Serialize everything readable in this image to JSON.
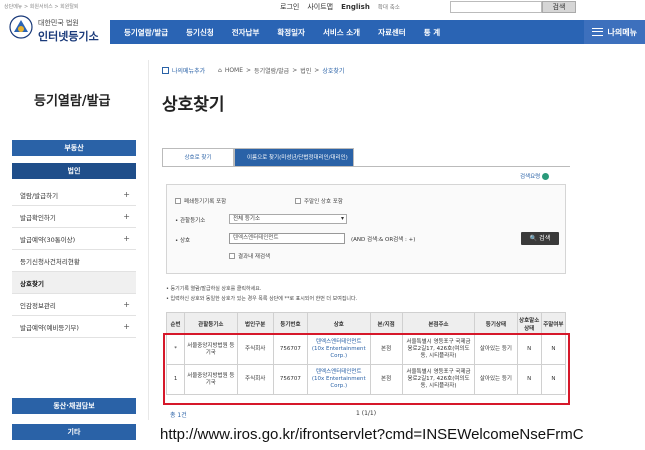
{
  "top_breadcrumb": "상단메뉴 > 회원서비스 > 회원탈퇴",
  "logo": {
    "sub": "대한민국 법원",
    "main": "인터넷등기소"
  },
  "util": {
    "login": "로그인",
    "sitemap": "사이트맵",
    "english": "English",
    "font_size": "확대 축소",
    "search_btn": "검색"
  },
  "nav": {
    "items": [
      "등기열람/발급",
      "등기신청",
      "전자납부",
      "확정일자",
      "서비스 소개",
      "자료센터",
      "통 계"
    ],
    "my_menu": "나의메뉴"
  },
  "sidebar": {
    "title": "등기열람/발급",
    "btn_realestate": "부동산",
    "btn_corp": "법인",
    "items": [
      {
        "label": "열람/발급하기",
        "plus": "+"
      },
      {
        "label": "발급확인하기",
        "plus": "+"
      },
      {
        "label": "발급예약(30통이상)",
        "plus": "+"
      },
      {
        "label": "등기신청사건처리현황",
        "plus": ""
      },
      {
        "label": "상호찾기",
        "plus": ""
      },
      {
        "label": "인감정보관리",
        "plus": "+"
      },
      {
        "label": "발급예약(예비등기부)",
        "plus": "+"
      }
    ],
    "btn_movable": "동산·채권담보",
    "btn_etc": "기타"
  },
  "content": {
    "favorite": "나의메뉴추가",
    "crumbs": [
      "HOME",
      ">",
      "등기열람/발급",
      ">",
      "법인",
      ">"
    ],
    "crumb_current": "상호찾기",
    "title": "상호찾기",
    "tab_active": "상호로 찾기",
    "tab_inactive": "이름으로 찾기(미성년/단법정대리인/대리인)",
    "hint": "검색요령",
    "form": {
      "chk_closed": "폐쇄등기기록 포함",
      "chk_main_only": "주말인 상호 포함",
      "label_office": "관할등기소",
      "office_value": "전체 등기소",
      "label_name": "상호",
      "name_value": "텐엑스엔터테인먼트",
      "and_or": "(AND 검색:& OR검색 : +)",
      "chk_within": "결과내 재검색",
      "search_btn": "검색"
    },
    "notes": [
      "• 등기기록 열람/발급하실 상호를 클릭하세요.",
      "• 입력하신 상호와 동일한 상호가 있는 경우 목록 상단에 **로 표시되어 한번 더 보여집니다."
    ]
  },
  "table": {
    "headers": [
      "순번",
      "관할등기소",
      "법인구분",
      "등기번호",
      "상호",
      "본/지점",
      "본점주소",
      "등기상태",
      "상호말소상태",
      "주말여부"
    ],
    "rows": [
      {
        "no": "*",
        "office": "서울중앙지방법원 등기국",
        "type": "주식회사",
        "reg_no": "756707",
        "name": "텐엑스엔터테인먼트(10x Entertainment Corp.)",
        "branch": "본점",
        "address": "서울특별시 영등포구 국제금융로2길17, 426호(여의도동, 시티플라자)",
        "status": "살아있는 등기",
        "cancel": "N",
        "main": "N"
      },
      {
        "no": "1",
        "office": "서울중앙지방법원 등기국",
        "type": "주식회사",
        "reg_no": "756707",
        "name": "텐엑스엔터테인먼트(10x Entertainment Corp.)",
        "branch": "본점",
        "address": "서울특별시 영등포구 국제금융로2길17, 426호(여의도동, 시티플라자)",
        "status": "살아있는 등기",
        "cancel": "N",
        "main": "N"
      }
    ],
    "total": "총 1건",
    "page": "1    (1/1)"
  },
  "url_caption": "http://www.iros.go.kr/ifrontservlet?cmd=INSEWelcomeNseFrmC",
  "colors": {
    "nav_blue": "#2a64b4",
    "sidebar_blue": "#2a62a7",
    "highlight_red": "#d6182a"
  }
}
